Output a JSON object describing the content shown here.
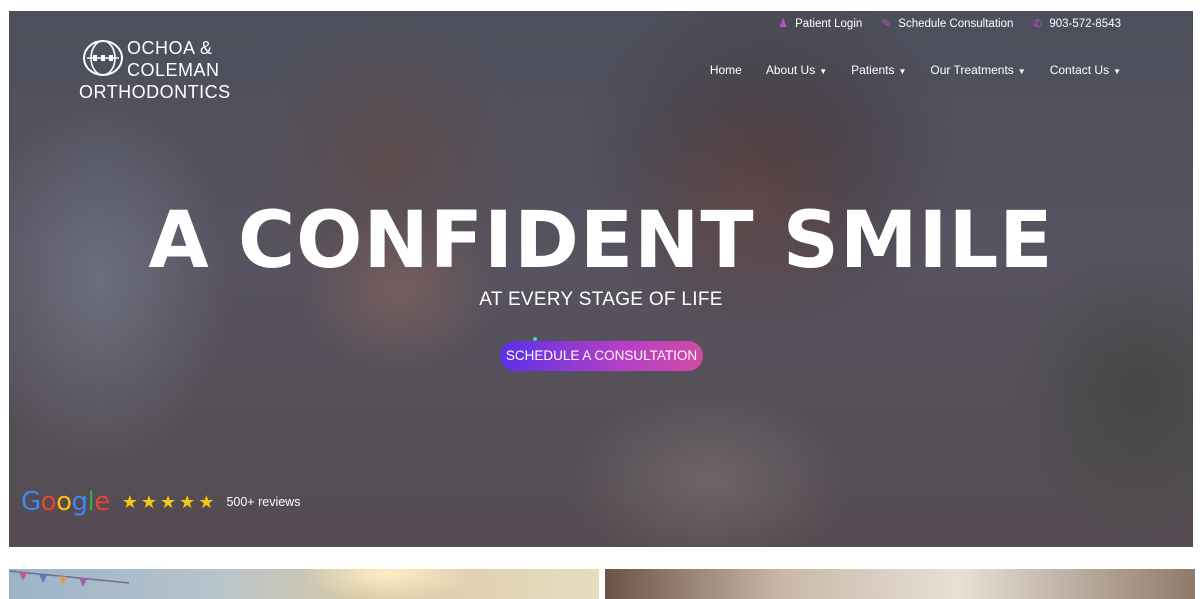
{
  "topbar": {
    "items": [
      {
        "label": "Patient Login",
        "icon": "user-icon"
      },
      {
        "label": "Schedule Consultation",
        "icon": "edit-icon"
      },
      {
        "label": "903-572-8543",
        "icon": "phone-icon"
      }
    ]
  },
  "logo": {
    "line1": "OCHOA &",
    "line2": "COLEMAN",
    "line3": "ORTHODONTICS"
  },
  "nav": {
    "items": [
      {
        "label": "Home",
        "has_dropdown": false
      },
      {
        "label": "About Us",
        "has_dropdown": true
      },
      {
        "label": "Patients",
        "has_dropdown": true
      },
      {
        "label": "Our Treatments",
        "has_dropdown": true
      },
      {
        "label": "Contact Us",
        "has_dropdown": true
      }
    ]
  },
  "hero": {
    "headline": "A CONFIDENT SMILE",
    "subheadline": "AT EVERY STAGE OF LIFE",
    "cta_label": "SCHEDULE A CONSULTATION"
  },
  "reviews": {
    "google": {
      "g1": "G",
      "o1": "o",
      "o2": "o",
      "g2": "g",
      "l": "l",
      "e": "e"
    },
    "rating_stars": 5,
    "count_label": "500+ reviews"
  },
  "colors": {
    "accent_pink": "#c44bd0",
    "cta_gradient_start": "#5a31e8",
    "cta_gradient_end": "#d04aa6",
    "star_color": "#f5c518"
  }
}
